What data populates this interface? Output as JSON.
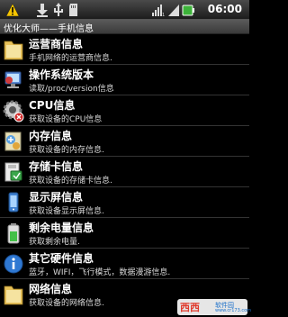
{
  "status": {
    "time": "06:00"
  },
  "titlebar": {
    "title": "优化大师——手机信息"
  },
  "items": [
    {
      "title": "运营商信息",
      "subtitle": "手机网络的运营商信息.",
      "icon": "folder-icon"
    },
    {
      "title": "操作系统版本",
      "subtitle": "读取/proc/version信息",
      "icon": "system-version-icon"
    },
    {
      "title": "CPU信息",
      "subtitle": "获取设备的CPU信息",
      "icon": "cpu-gear-icon"
    },
    {
      "title": "内存信息",
      "subtitle": "获取设备的内存信息.",
      "icon": "memory-icon"
    },
    {
      "title": "存储卡信息",
      "subtitle": "获取设备的存储卡信息.",
      "icon": "sdcard-icon"
    },
    {
      "title": "显示屏信息",
      "subtitle": "获取设备显示屏信息.",
      "icon": "display-icon"
    },
    {
      "title": "剩余电量信息",
      "subtitle": "获取剩余电量.",
      "icon": "battery-icon"
    },
    {
      "title": "其它硬件信息",
      "subtitle": "蓝牙，WIFI，飞行模式，数据漫游信息.",
      "icon": "info-icon"
    },
    {
      "title": "网络信息",
      "subtitle": "获取设备的网络信息.",
      "icon": "network-icon"
    }
  ],
  "watermark": {
    "brand": "西西",
    "name": "软件园",
    "url": "www.cr173.com"
  }
}
